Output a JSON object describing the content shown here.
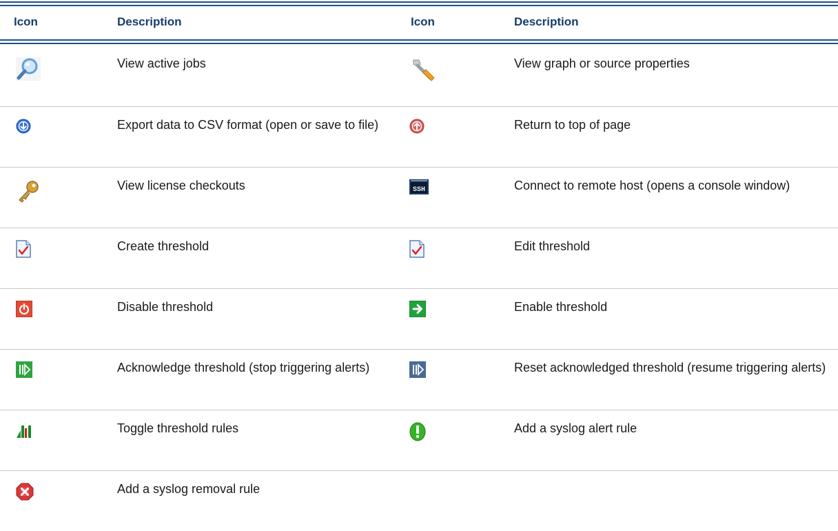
{
  "header": {
    "col1": "Icon",
    "col2": "Description",
    "col3": "Icon",
    "col4": "Description"
  },
  "rows": [
    {
      "left": {
        "icon": "magnifier-icon",
        "text": "View active jobs"
      },
      "right": {
        "icon": "wrench-icon",
        "text": "View graph or source properties"
      }
    },
    {
      "left": {
        "icon": "export-down-arrow-icon",
        "text": "Export data to CSV format (open or save to file)"
      },
      "right": {
        "icon": "up-arrow-icon",
        "text": "Return to top of page"
      }
    },
    {
      "left": {
        "icon": "key-icon",
        "text": "View license checkouts"
      },
      "right": {
        "icon": "ssh-console-icon",
        "text": "Connect to remote host (opens a console window)"
      }
    },
    {
      "left": {
        "icon": "checked-doc-icon",
        "text": "Create threshold"
      },
      "right": {
        "icon": "checked-doc-icon",
        "text": "Edit threshold"
      }
    },
    {
      "left": {
        "icon": "power-off-icon",
        "text": "Disable threshold"
      },
      "right": {
        "icon": "green-arrow-icon",
        "text": "Enable threshold"
      }
    },
    {
      "left": {
        "icon": "acknowledge-icon",
        "text": "Acknowledge threshold (stop triggering alerts)"
      },
      "right": {
        "icon": "reset-acknowledge-icon",
        "text": "Reset acknowledged threshold (resume triggering alerts)"
      }
    },
    {
      "left": {
        "icon": "bars-icon",
        "text": "Toggle threshold rules"
      },
      "right": {
        "icon": "exclamation-icon",
        "text": "Add a syslog alert rule"
      }
    },
    {
      "left": {
        "icon": "red-x-icon",
        "text": "Add a syslog removal rule"
      },
      "right": {
        "icon": "",
        "text": ""
      }
    }
  ]
}
